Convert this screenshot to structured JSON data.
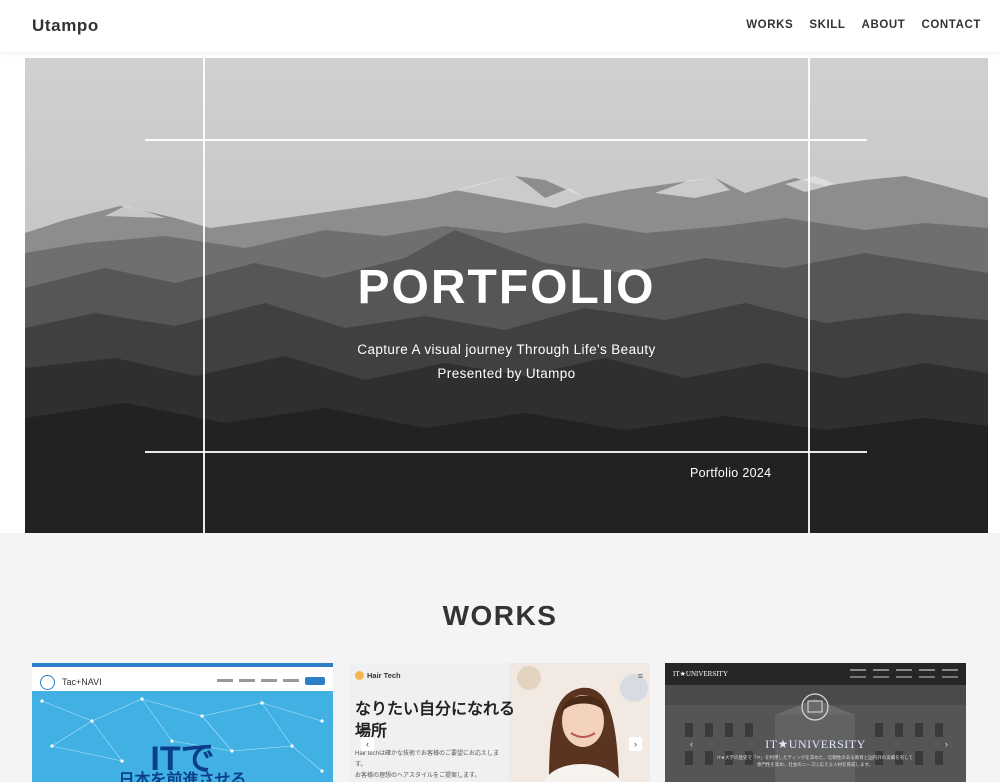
{
  "header": {
    "logo": "Utampo",
    "nav": [
      "WORKS",
      "SKILL",
      "ABOUT",
      "CONTACT"
    ]
  },
  "hero": {
    "title": "PORTFOLIO",
    "subtitle_line1": "Capture A visual journey Through Life's Beauty",
    "subtitle_line2": "Presented by Utampo",
    "year_label": "Portfolio 2024"
  },
  "works": {
    "title": "WORKS",
    "cards": [
      {
        "brand": "Tac+NAVI",
        "headline": "ITで",
        "headline2": "日本を前進させる"
      },
      {
        "brand": "Hair Tech",
        "menu_icon": "≡",
        "catch_line1": "なりたい自分になれる",
        "catch_line2": "場所",
        "body_line1": "Hair techは確かな技術でお客様のご要望にお応えします。",
        "body_line2": "お客様の理想のヘアスタイルをご提案します。",
        "prev": "‹",
        "next": "›"
      },
      {
        "brand": "IT★UNIVERSITY",
        "headline": "IT★UNIVERSITY",
        "body": "IT★大学の歴史で「IT」を利用したティングを求めた、信頼性のある教育と国内外の実績を有して専門性を高め、社会のニーズに応える人材を育成します。",
        "prev": "‹",
        "next": "›"
      }
    ]
  }
}
